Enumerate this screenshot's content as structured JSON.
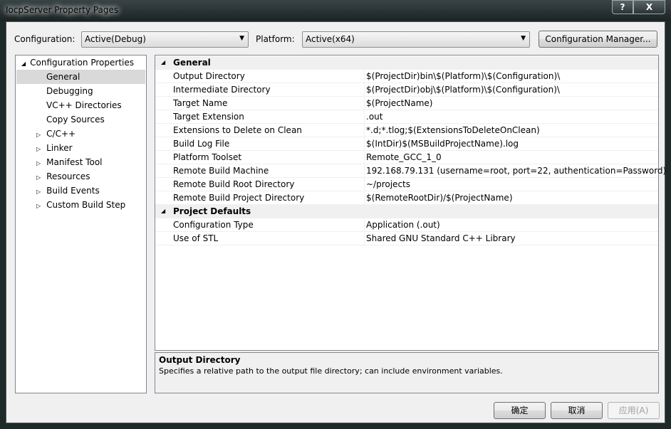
{
  "window": {
    "title": "IocpServer Property Pages",
    "help": "?",
    "close": "X"
  },
  "toolbar": {
    "configuration_label": "Configuration:",
    "configuration_value": "Active(Debug)",
    "platform_label": "Platform:",
    "platform_value": "Active(x64)",
    "config_manager": "Configuration Manager..."
  },
  "tree": {
    "root": "Configuration Properties",
    "items": [
      {
        "label": "General",
        "expandable": false,
        "selected": true
      },
      {
        "label": "Debugging",
        "expandable": false
      },
      {
        "label": "VC++ Directories",
        "expandable": false
      },
      {
        "label": "Copy Sources",
        "expandable": false
      },
      {
        "label": "C/C++",
        "expandable": true
      },
      {
        "label": "Linker",
        "expandable": true
      },
      {
        "label": "Manifest Tool",
        "expandable": true
      },
      {
        "label": "Resources",
        "expandable": true
      },
      {
        "label": "Build Events",
        "expandable": true
      },
      {
        "label": "Custom Build Step",
        "expandable": true
      }
    ]
  },
  "grid": {
    "sections": [
      {
        "title": "General",
        "rows": [
          {
            "name": "Output Directory",
            "value": "$(ProjectDir)bin\\$(Platform)\\$(Configuration)\\"
          },
          {
            "name": "Intermediate Directory",
            "value": "$(ProjectDir)obj\\$(Platform)\\$(Configuration)\\"
          },
          {
            "name": "Target Name",
            "value": "$(ProjectName)"
          },
          {
            "name": "Target Extension",
            "value": ".out"
          },
          {
            "name": "Extensions to Delete on Clean",
            "value": "*.d;*.tlog;$(ExtensionsToDeleteOnClean)"
          },
          {
            "name": "Build Log File",
            "value": "$(IntDir)$(MSBuildProjectName).log"
          },
          {
            "name": "Platform Toolset",
            "value": "Remote_GCC_1_0"
          },
          {
            "name": "Remote Build Machine",
            "value": "192.168.79.131 (username=root, port=22, authentication=Password)"
          },
          {
            "name": "Remote Build Root Directory",
            "value": "~/projects"
          },
          {
            "name": "Remote Build Project Directory",
            "value": "$(RemoteRootDir)/$(ProjectName)"
          }
        ]
      },
      {
        "title": "Project Defaults",
        "rows": [
          {
            "name": "Configuration Type",
            "value": "Application (.out)"
          },
          {
            "name": "Use of STL",
            "value": "Shared GNU Standard C++ Library"
          }
        ]
      }
    ]
  },
  "description": {
    "title": "Output Directory",
    "text": "Specifies a relative path to the output file directory; can include environment variables."
  },
  "buttons": {
    "ok": "确定",
    "cancel": "取消",
    "apply": "应用(A)"
  }
}
